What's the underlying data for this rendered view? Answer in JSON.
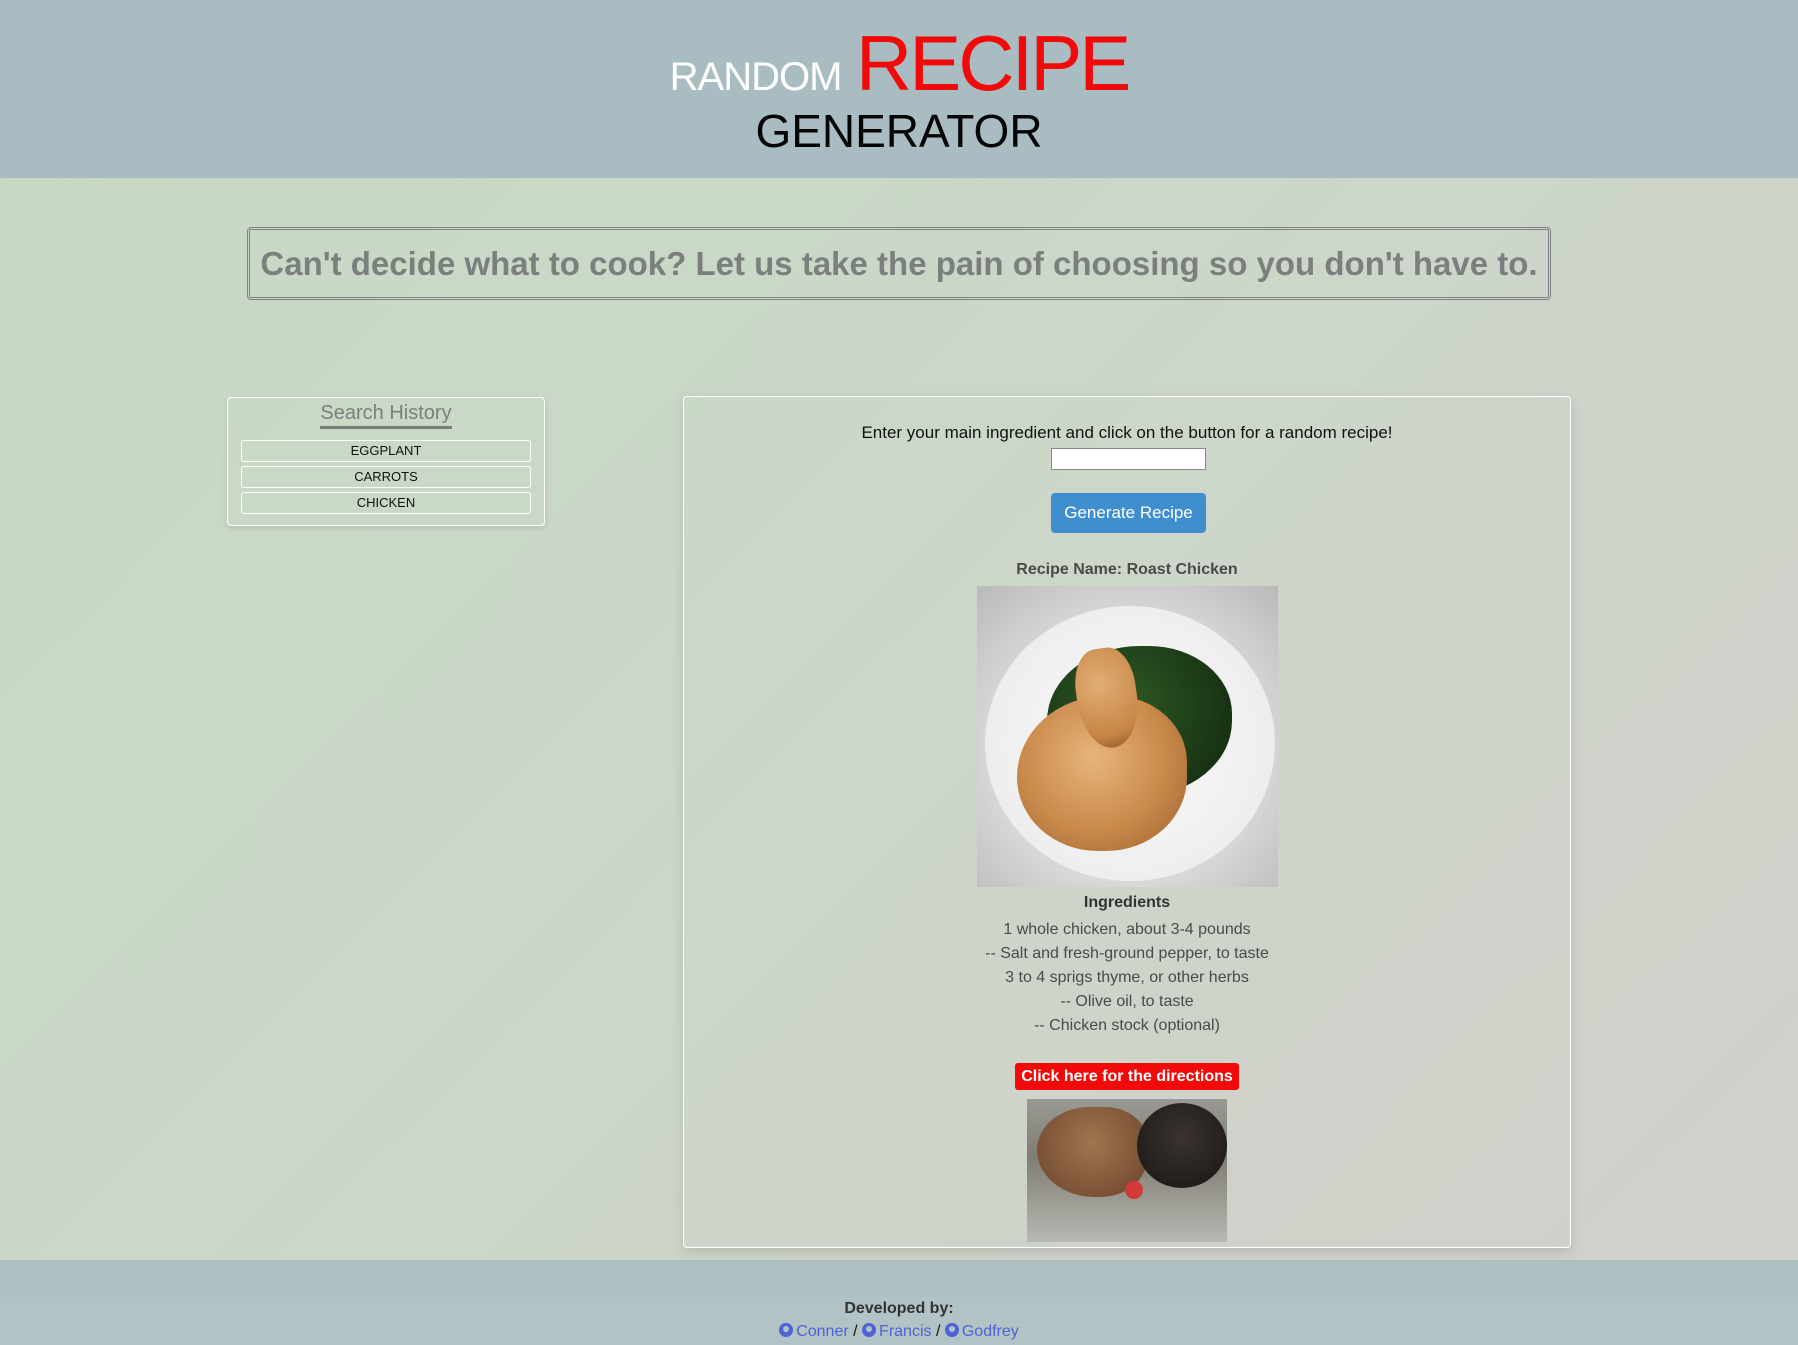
{
  "header": {
    "title_small": "RANDOM",
    "title_large": "RECIPE",
    "title_second_line": "GENERATOR"
  },
  "tagline": "Can't decide what to cook? Let us take the pain of choosing so you don't have to.",
  "search_history": {
    "title": "Search History",
    "items": [
      "EGGPLANT",
      "CARROTS",
      "CHICKEN"
    ]
  },
  "generator": {
    "prompt": "Enter your main ingredient and click on the button for a random recipe!",
    "input_value": "",
    "button_label": "Generate Recipe"
  },
  "recipe": {
    "name_label": "Recipe Name: Roast Chicken",
    "ingredients_title": "Ingredients",
    "ingredients": [
      "1 whole chicken, about 3-4 pounds",
      "-- Salt and fresh-ground pepper, to taste",
      "3 to 4 sprigs thyme, or other herbs",
      "-- Olive oil, to taste",
      "-- Chicken stock (optional)"
    ],
    "directions_button": "Click here for the directions"
  },
  "footer": {
    "developed_by": "Developed by:",
    "separator": "/",
    "developers": [
      "Conner",
      "Francis",
      "Godfrey"
    ]
  },
  "colors": {
    "accent_red": "#f20a0a",
    "button_blue": "#3e8ed0",
    "header_bg": "#a9bcc1",
    "link_blue": "#4d63d6"
  }
}
